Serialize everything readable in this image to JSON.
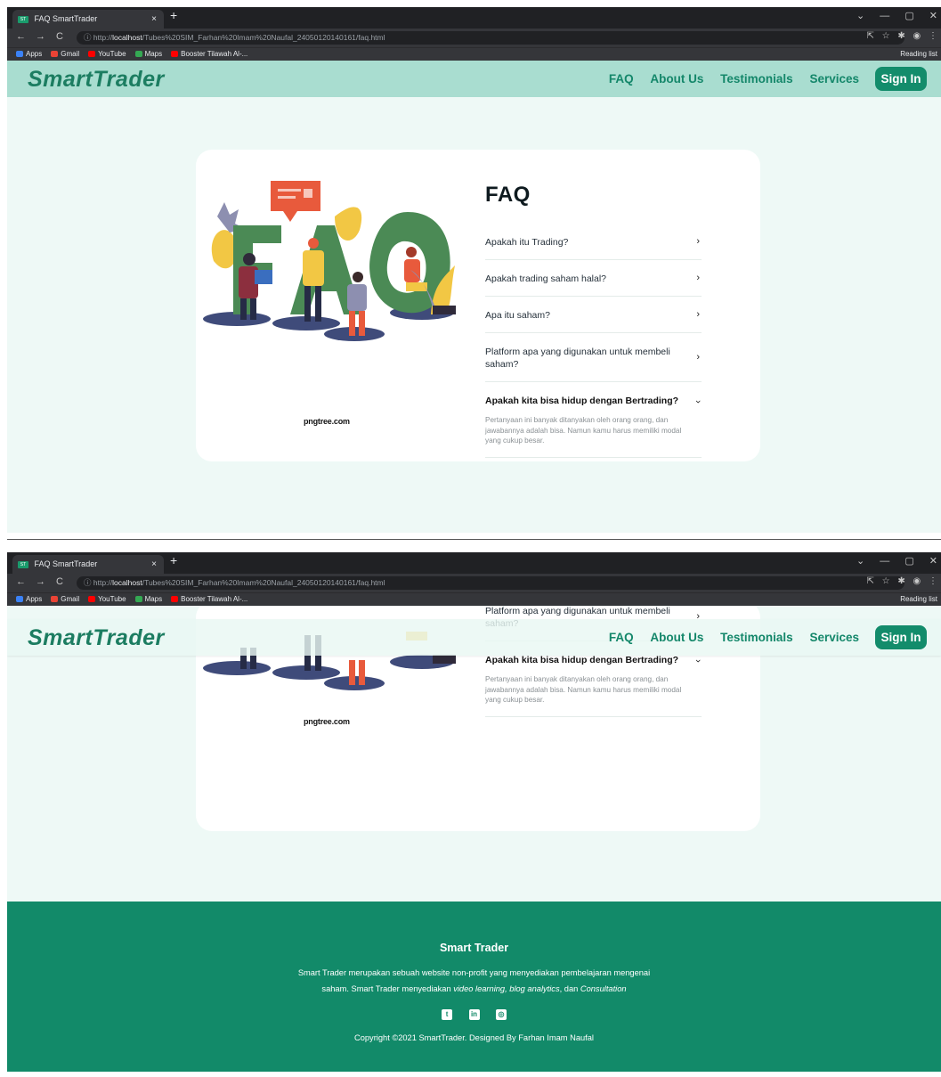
{
  "browser": {
    "tab_title": "FAQ SmartTrader",
    "favicon_text": "ST",
    "tab_close": "×",
    "new_tab": "+",
    "window_controls": "⌄ — ▢ ✕",
    "nav": {
      "back": "←",
      "forward": "→",
      "reload": "C"
    },
    "url_prefix": "http://",
    "url_host": "localhost",
    "url_path": "/Tubes%20SIM_Farhan%20Imam%20Naufal_24050120140161/faq.html",
    "url_icons": "⇱ ☆ ✱ ◉ ⋮",
    "bookmarks": [
      {
        "label": "Apps",
        "color": "#3b82f6"
      },
      {
        "label": "Gmail",
        "color": "#ea4335"
      },
      {
        "label": "YouTube",
        "color": "#ff0000"
      },
      {
        "label": "Maps",
        "color": "#34a853"
      },
      {
        "label": "Booster Tilawah Al-...",
        "color": "#ff0000"
      }
    ],
    "reading_list": "Reading list"
  },
  "site": {
    "brand": "SmartTrader",
    "nav": [
      "FAQ",
      "About Us",
      "Testimonials",
      "Services"
    ],
    "signin": "Sign In"
  },
  "faq": {
    "title": "FAQ",
    "image_credit": "pngtree.com",
    "items": [
      {
        "question": "Apakah itu Trading?",
        "open": false
      },
      {
        "question": "Apakah trading saham halal?",
        "open": false
      },
      {
        "question": "Apa itu saham?",
        "open": false
      },
      {
        "question": "Platform apa yang digunakan untuk membeli saham?",
        "open": false
      },
      {
        "question": "Apakah kita bisa hidup dengan Bertrading?",
        "open": true,
        "answer": "Pertanyaan ini banyak ditanyakan oleh orang orang, dan jawabannya adalah bisa. Namun kamu harus memiliki modal yang cukup besar."
      }
    ],
    "chevron": "›"
  },
  "footer": {
    "title": "Smart Trader",
    "desc_part1": "Smart Trader merupakan sebuah website non-profit yang menyediakan pembelajaran mengenai saham. Smart Trader menyediakan ",
    "desc_italic1": "video learning, blog analytics",
    "desc_part2": ", dan ",
    "desc_italic2": "Consultation",
    "socials": [
      "t",
      "in",
      "◎"
    ],
    "copyright": "Copyright ©2021 SmartTrader. Designed By Farhan Imam Naufal"
  },
  "colors": {
    "brand_green": "#1c7d61",
    "nav_bg": "#a9ddd0",
    "page_bg": "#eef9f6",
    "footer_bg": "#128a69",
    "signin_bg": "#138c6b"
  }
}
